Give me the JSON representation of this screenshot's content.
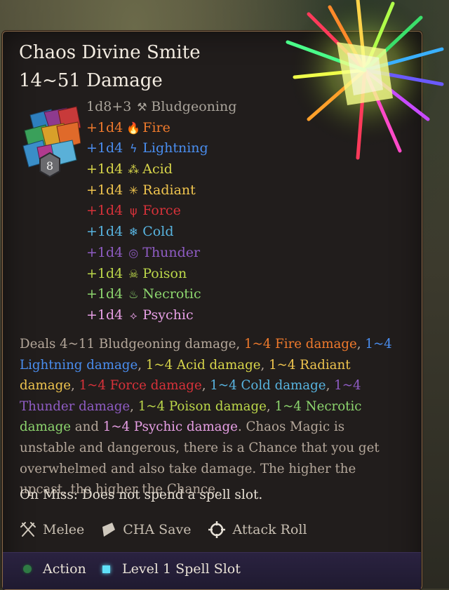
{
  "spell": {
    "name": "Chaos Divine Smite",
    "damage_range": "14~51 Damage"
  },
  "dice_badge": {
    "value": "8"
  },
  "damage_lines": [
    {
      "amount": "1d8+3",
      "type": "Bludgeoning",
      "color": "#a9a39a",
      "icon": "hammer-icon"
    },
    {
      "amount": "+1d4",
      "type": "Fire",
      "color": "#f07a2c",
      "icon": "fire-icon"
    },
    {
      "amount": "+1d4",
      "type": "Lightning",
      "color": "#4a8ef0",
      "icon": "lightning-icon"
    },
    {
      "amount": "+1d4",
      "type": "Acid",
      "color": "#d9d64a",
      "icon": "acid-icon"
    },
    {
      "amount": "+1d4",
      "type": "Radiant",
      "color": "#efc44e",
      "icon": "radiant-icon"
    },
    {
      "amount": "+1d4",
      "type": "Force",
      "color": "#d8323a",
      "icon": "force-icon"
    },
    {
      "amount": "+1d4",
      "type": "Cold",
      "color": "#58b4e0",
      "icon": "cold-icon"
    },
    {
      "amount": "+1d4",
      "type": "Thunder",
      "color": "#8f5cc4",
      "icon": "thunder-icon"
    },
    {
      "amount": "+1d4",
      "type": "Poison",
      "color": "#bcd84a",
      "icon": "poison-icon"
    },
    {
      "amount": "+1d4",
      "type": "Necrotic",
      "color": "#8dd66e",
      "icon": "necrotic-icon"
    },
    {
      "amount": "+1d4",
      "type": "Psychic",
      "color": "#e8a0e6",
      "icon": "psychic-icon"
    }
  ],
  "description": {
    "intro": "Deals 4~11 Bludgeoning damage, ",
    "fire": "1~4 Fire damage",
    "lightning": "1~4 Lightning damage",
    "acid": "1~4 Acid damage",
    "radiant": "1~4 Radiant damage",
    "force": "1~4 Force damage",
    "cold": "1~4 Cold damage",
    "thunder": "1~4 Thunder damage",
    "poison": "1~4 Poison damage",
    "necrotic": "1~4 Necrotic damage",
    "and": " and ",
    "psychic": "1~4 Psychic damage",
    "sep": ", ",
    "period": ".",
    "chaos_text": " Chaos Magic is unstable and dangerous, there is a Chance that you get overwhelmed and also take damage. The higher the upcast, the higher the Chance."
  },
  "on_miss": "On Miss: Does not spend a spell slot.",
  "tags": [
    {
      "label": "Melee",
      "icon": "crossed-swords-icon"
    },
    {
      "label": "CHA Save",
      "icon": "shield-icon"
    },
    {
      "label": "Attack Roll",
      "icon": "crosshair-icon"
    }
  ],
  "costs": {
    "action": {
      "label": "Action",
      "color": "#2f8a4a"
    },
    "spell_slot": {
      "label": "Level 1 Spell Slot",
      "color": "#58d8f0"
    }
  }
}
